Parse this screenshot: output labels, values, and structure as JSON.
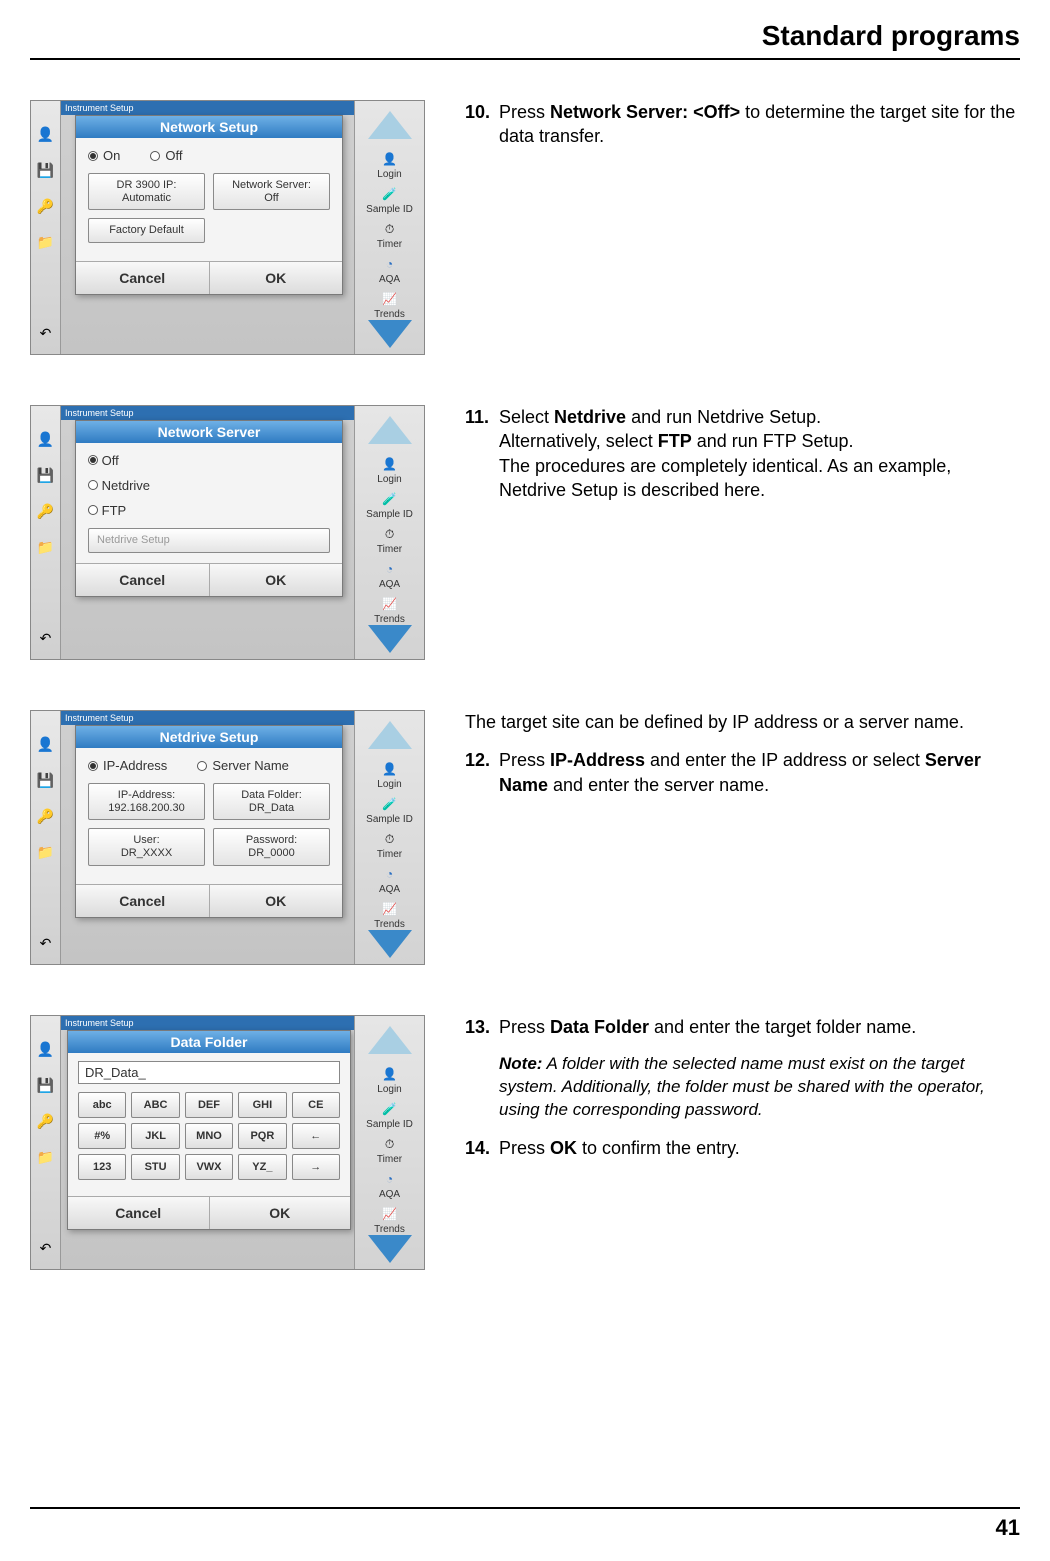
{
  "header": {
    "title": "Standard programs"
  },
  "footer": {
    "page": "41"
  },
  "section1": {
    "step_num": "10.",
    "text_before": "Press ",
    "bold1": "Network Server: <Off>",
    "text_after": " to determine the target site for the data transfer.",
    "ss": {
      "topstrip": "Instrument Setup",
      "title": "Network Setup",
      "radio_on": "On",
      "radio_off": "Off",
      "btn1a": "DR 3900 IP:",
      "btn1b": "Automatic",
      "btn2a": "Network Server:",
      "btn2b": "Off",
      "btn3": "Factory Default",
      "cancel": "Cancel",
      "ok": "OK",
      "r_login": "Login",
      "r_sample": "Sample ID",
      "r_timer": "Timer",
      "r_aqa": "AQA",
      "r_trends": "Trends"
    }
  },
  "section2": {
    "step_num": "11.",
    "line1a": "Select ",
    "bold1": "Netdrive",
    "line1b": " and run Netdrive Setup.",
    "line2a": "Alternatively, select ",
    "bold2": "FTP",
    "line2b": " and run FTP Setup.",
    "line3": "The procedures are completely identical. As an example, Netdrive Setup is described here.",
    "ss": {
      "topstrip": "Instrument Setup",
      "title": "Network Server",
      "opt_off": "Off",
      "opt_netdrive": "Netdrive",
      "opt_ftp": "FTP",
      "btn_setup": "Netdrive Setup",
      "cancel": "Cancel",
      "ok": "OK"
    }
  },
  "section3": {
    "lead": "The target site can be defined by IP address or a server name.",
    "step_num": "12.",
    "text_a": "Press ",
    "bold1": "IP-Address",
    "text_b": " and enter the IP address or select ",
    "bold2": "Server Name",
    "text_c": " and enter the server name.",
    "ss": {
      "topstrip": "Instrument Setup",
      "title": "Netdrive Setup",
      "radio_ip": "IP-Address",
      "radio_sn": "Server Name",
      "btn1a": "IP-Address:",
      "btn1b": "192.168.200.30",
      "btn2a": "Data Folder:",
      "btn2b": "DR_Data",
      "btn3a": "User:",
      "btn3b": "DR_XXXX",
      "btn4a": "Password:",
      "btn4b": "DR_0000",
      "cancel": "Cancel",
      "ok": "OK"
    }
  },
  "section4": {
    "step13_num": "13.",
    "step13_a": "Press ",
    "step13_bold": "Data Folder",
    "step13_b": " and enter the target folder name.",
    "note_label": "Note:",
    "note_body": " A folder with the selected name must exist on the target system. Additionally, the folder must be shared with the operator, using the corresponding password.",
    "step14_num": "14.",
    "step14_a": "Press ",
    "step14_bold": "OK",
    "step14_b": " to confirm the entry.",
    "ss": {
      "topstrip": "Instrument Setup",
      "title": "Data Folder",
      "input": "DR_Data_",
      "keys": [
        "abc",
        "ABC",
        "DEF",
        "GHI",
        "CE",
        "#%",
        "JKL",
        "MNO",
        "PQR",
        "←",
        "123",
        "STU",
        "VWX",
        "YZ_",
        "→"
      ],
      "cancel": "Cancel",
      "ok": "OK"
    }
  },
  "icons": {
    "left": [
      "👤",
      "💾",
      "🔑",
      "📁",
      "↶"
    ]
  }
}
